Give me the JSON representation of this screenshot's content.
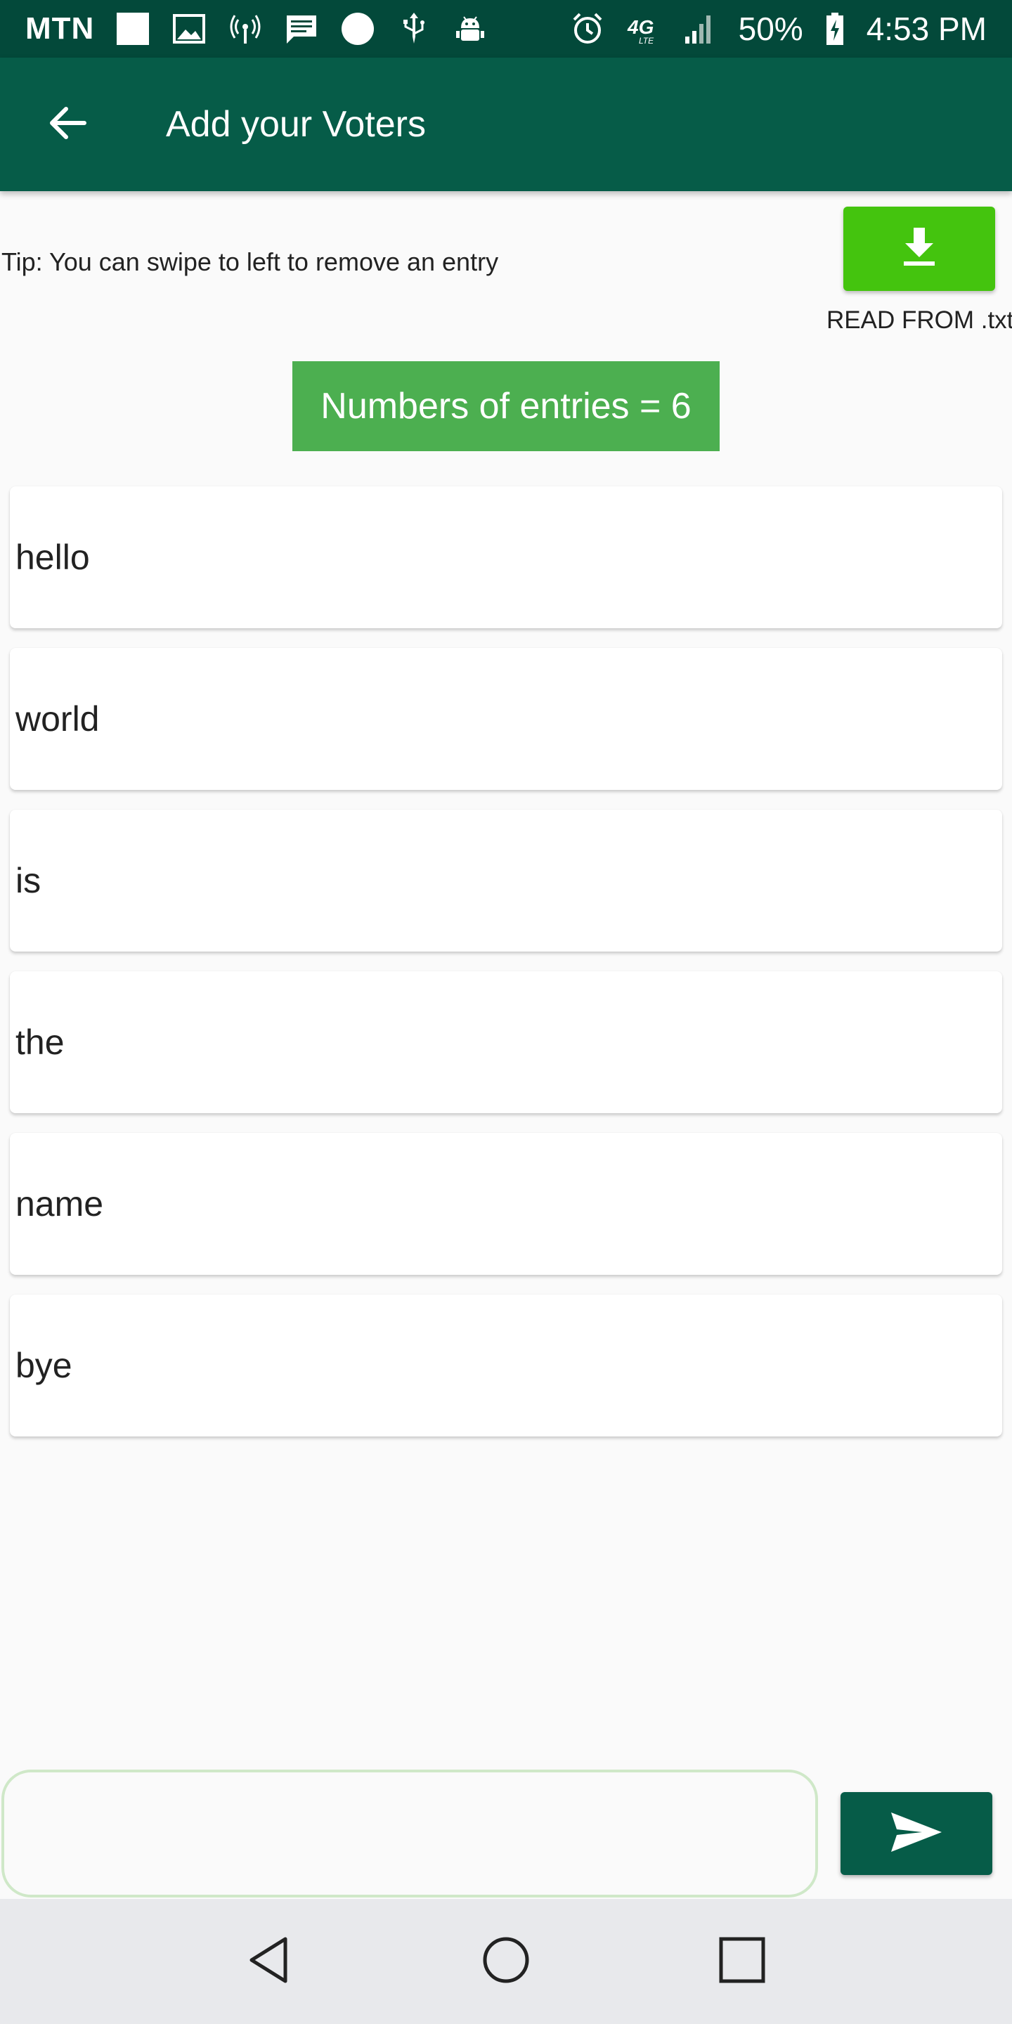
{
  "status_bar": {
    "carrier": "MTN",
    "battery": "50%",
    "time": "4:53 PM",
    "icons": [
      "white-square-icon",
      "image-icon",
      "hotspot-icon",
      "message-icon",
      "circle-icon",
      "usb-icon",
      "android-debug-icon",
      "alarm-icon",
      "4g-lte-icon",
      "signal-icon",
      "battery-charging-icon"
    ]
  },
  "app_bar": {
    "title": "Add your Voters",
    "back_icon": "arrow-back-icon"
  },
  "tip": "Tip: You can swipe to left to remove an entry",
  "download": {
    "label": "READ FROM .txt",
    "icon": "download-icon",
    "color": "#44c40e"
  },
  "counter": "Numbers of entries = 6",
  "entries": [
    "hello",
    "world",
    "is",
    "the",
    "name",
    "bye"
  ],
  "input": {
    "value": "",
    "placeholder": ""
  },
  "send": {
    "icon": "send-icon",
    "color": "#065c48"
  },
  "nav_bar": {
    "icons": [
      "back-triangle-icon",
      "home-circle-icon",
      "recents-square-icon"
    ]
  },
  "colors": {
    "status_bar": "#03493a",
    "app_bar": "#065c48",
    "accent": "#4caf50"
  }
}
